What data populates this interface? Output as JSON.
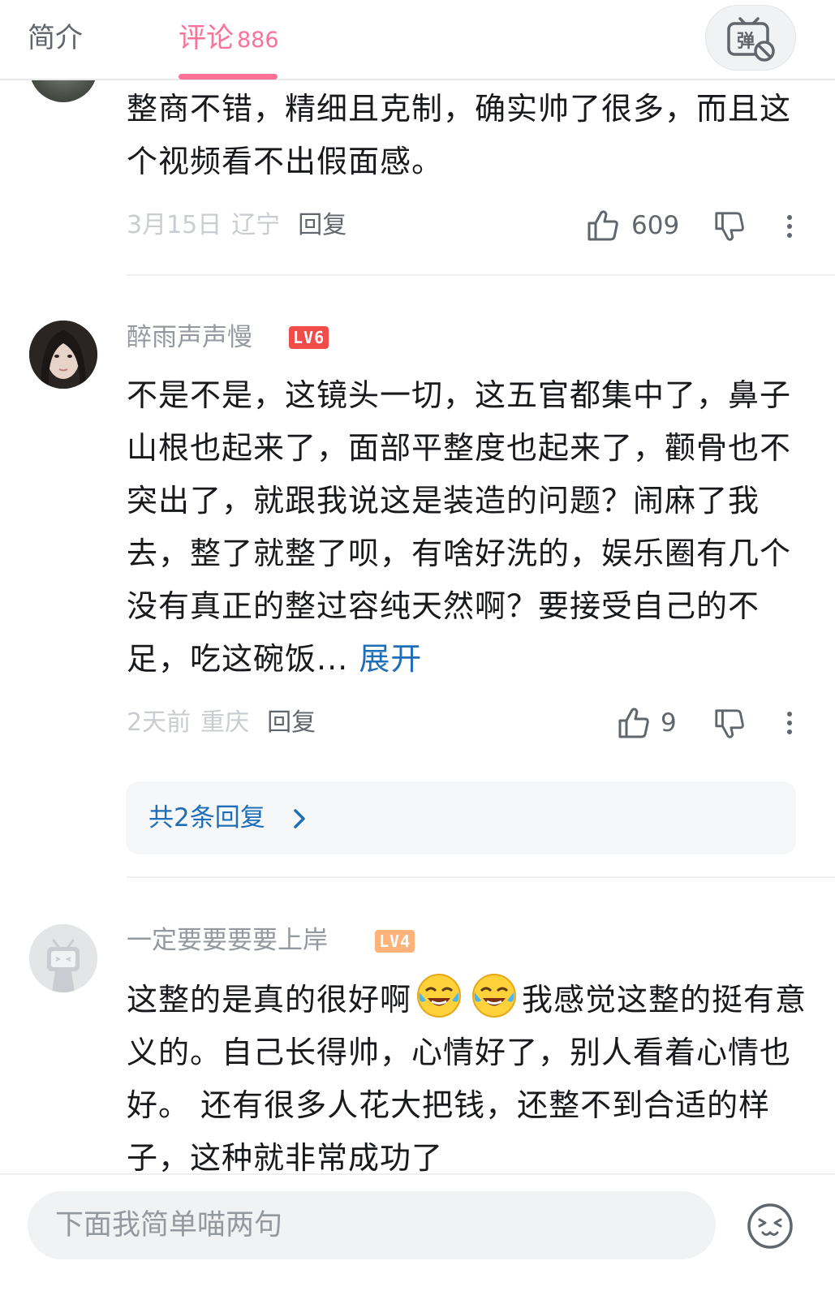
{
  "tabs": {
    "intro": "简介",
    "comments": "评论",
    "comments_count": "886"
  },
  "comments": [
    {
      "text": "整商不错，精细且克制，确实帅了很多，而且这个视频看不出假面感。",
      "date": "3月15日",
      "location": "辽宁",
      "reply": "回复",
      "likes": "609"
    },
    {
      "username": "醉雨声声慢",
      "level": "LV6",
      "text": "不是不是，这镜头一切，这五官都集中了，鼻子山根也起来了，面部平整度也起来了，颧骨也不突出了，就跟我说这是装造的问题？闹麻了我去，整了就整了呗，有啥好洗的，娱乐圈有几个没有真正的整过容纯天然啊？要接受自己的不足，吃这碗饭...",
      "expand": "展开",
      "date": "2天前",
      "location": "重庆",
      "reply": "回复",
      "likes": "9",
      "replies_label": "共2条回复"
    },
    {
      "username": "一定要要要要上岸",
      "level": "LV4",
      "text_part1": "这整的是真的很好啊",
      "text_part2": "我感觉这整的挺有意义的。自己长得帅，心情好了，别人看着心情也好。 还有很多人花大把钱，还整不到合适的样子，这种就非常成功了"
    }
  ],
  "input": {
    "placeholder": "下面我简单喵两句"
  },
  "colors": {
    "accent_pink": "#fb7299",
    "link_blue": "#1e6fb8",
    "lv6": "#f04c49",
    "lv4": "#ffb27a"
  },
  "icons": [
    "danmaku-off-icon",
    "thumbs-up-icon",
    "thumbs-down-icon",
    "more-vertical-icon",
    "chevron-right-icon",
    "crying-laugh-emoji-icon",
    "emoji-face-icon"
  ]
}
